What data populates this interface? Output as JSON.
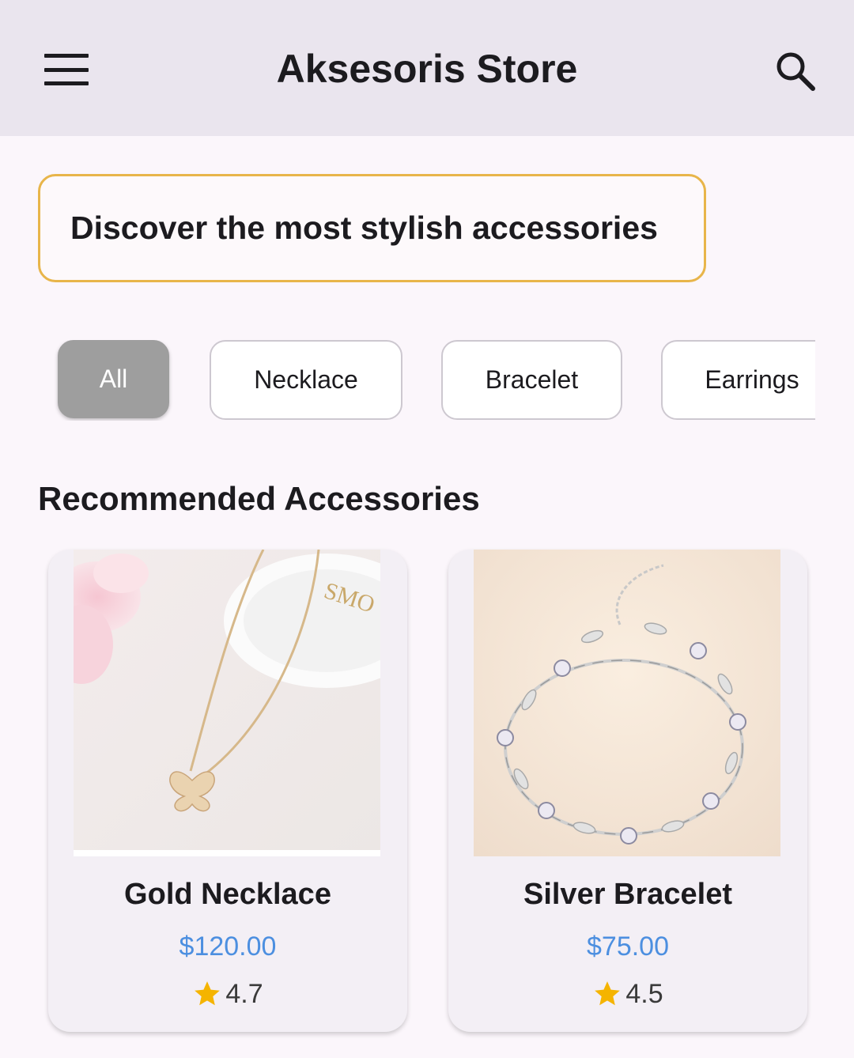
{
  "app_bar": {
    "title": "Aksesoris Store",
    "menu_icon": "hamburger-menu-icon",
    "search_icon": "search-icon"
  },
  "banner": {
    "text": "Discover the most stylish accessories",
    "border_color": "#e8b54a"
  },
  "categories": {
    "selected": "All",
    "items": [
      {
        "label": "All"
      },
      {
        "label": "Necklace"
      },
      {
        "label": "Bracelet"
      },
      {
        "label": "Earrings"
      }
    ]
  },
  "section": {
    "title": "Recommended Accessories"
  },
  "products": [
    {
      "name": "Gold Necklace",
      "price": "$120.00",
      "rating": "4.7",
      "image": "gold-necklace-photo"
    },
    {
      "name": "Silver Bracelet",
      "price": "$75.00",
      "rating": "4.5",
      "image": "silver-bracelet-photo"
    }
  ],
  "colors": {
    "app_bar_bg": "#eae5ee",
    "page_bg": "#fbf6fb",
    "price": "#4c8fe0",
    "star": "#f5b400",
    "chip_selected_bg": "#9e9e9e"
  }
}
